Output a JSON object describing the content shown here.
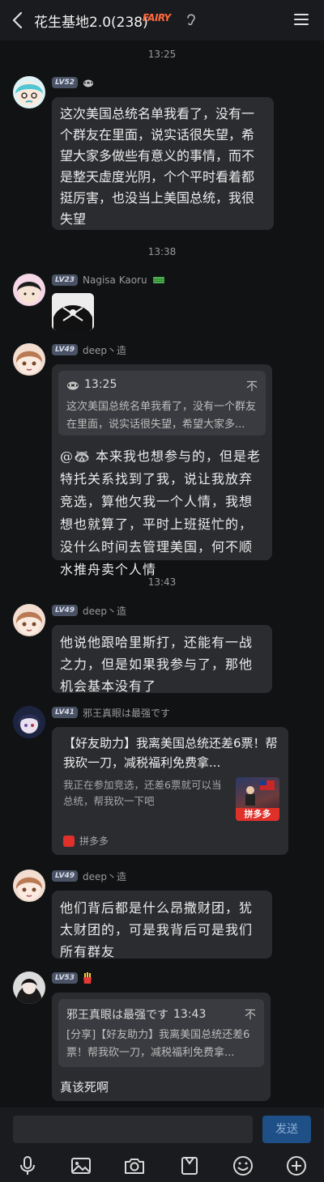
{
  "header": {
    "title": "花生基地2.0(238)",
    "badge_art": "FAIRY",
    "back_icon": "chevron-left-icon",
    "menu_icon": "hamburger-menu-icon",
    "ear_icon": "ear-icon"
  },
  "timestamps": [
    "13:25",
    "13:38",
    "13:43"
  ],
  "messages": [
    {
      "level": "LV52",
      "name_icon": "raccoon-emoji",
      "text": "这次美国总统名单我看了，没有一个群友在里面，说实话很失望，希望大家多做些有意义的事情，而不是整天虚度光阴，个个平时看着都挺厉害，也没当上美国总统，我很失望"
    },
    {
      "level": "LV23",
      "name": "Nagisa Kaoru",
      "name_icon": "money-emoji",
      "content": "image"
    },
    {
      "level": "LV49",
      "name": "deep丶造",
      "quote": {
        "time": "13:25",
        "text": "这次美国总统名单我看了，没有一个群友在里面，说实话很失望，希望大家多...",
        "pin_label": "不"
      },
      "text": "@🦝 本来我也想参与的，但是老特托关系找到了我，说让我放弃竞选，算他欠我一个人情，我想想也就算了，平时上班挺忙的，没什么时间去管理美国，何不顺水推舟卖个人情"
    },
    {
      "level": "LV49",
      "name": "deep丶造",
      "text": "他说他跟哈里斯打，还能有一战之力，但是如果我参与了，那他机会基本没有了"
    },
    {
      "level": "LV41",
      "name": "邪王真眼は最强です",
      "card": {
        "title": "【好友助力】我离美国总统还差6票！帮我砍一刀，减税福利免费拿...",
        "desc": "我正在参加竞选，还差6票就可以当总统，帮我砍一下吧",
        "thumb_label": "拼多多",
        "source": "拼多多"
      }
    },
    {
      "level": "LV49",
      "name": "deep丶造",
      "text": "他们背后都是什么昂撒财团，犹太财团的，可是我背后可是我们所有群友"
    },
    {
      "level": "LV53",
      "name_icon": "fries-emoji",
      "quote": {
        "sender": "邪王真眼は最强です",
        "time": "13:43",
        "text": "[分享]【好友助力】我离美国总统还差6票！帮我砍一刀，减税福利免费拿...",
        "pin_label": "不"
      },
      "text": "真该死啊"
    }
  ],
  "input": {
    "send_label": "发送",
    "tools": [
      "microphone-icon",
      "image-icon",
      "camera-icon",
      "file-icon",
      "emoji-icon",
      "plus-icon"
    ]
  },
  "colors": {
    "background": "#111214",
    "bubble": "#2b2c30",
    "quote": "#3a3b40",
    "send": "#1e4f86"
  }
}
